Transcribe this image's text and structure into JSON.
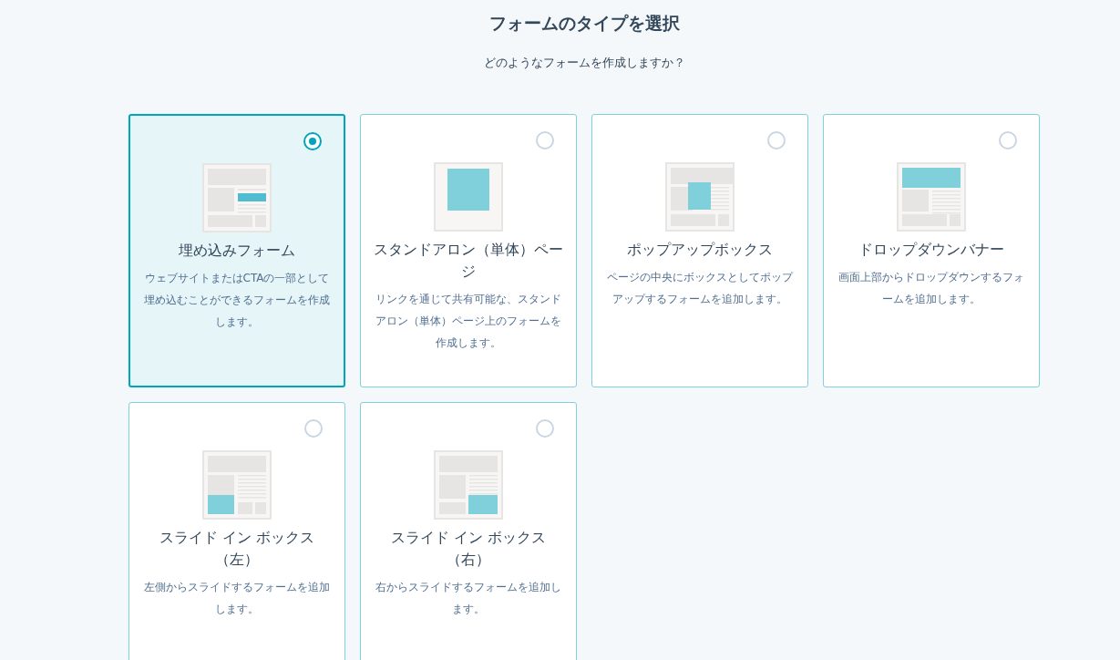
{
  "heading": "フォームのタイプを選択",
  "subheading": "どのようなフォームを作成しますか？",
  "options": [
    {
      "kind": "embedded",
      "title": "埋め込みフォーム",
      "description": "ウェブサイトまたはCTAの一部として埋め込むことができるフォームを作成します。",
      "selected": true
    },
    {
      "kind": "standalone",
      "title": "スタンドアロン（単体）ページ",
      "description": "リンクを通じて共有可能な、スタンドアロン（単体）ページ上のフォームを作成します。",
      "selected": false
    },
    {
      "kind": "popup",
      "title": "ポップアップボックス",
      "description": "ページの中央にボックスとしてポップアップするフォームを追加します。",
      "selected": false
    },
    {
      "kind": "dropdown",
      "title": "ドロップダウンバナー",
      "description": "画面上部からドロップダウンするフォームを追加します。",
      "selected": false
    },
    {
      "kind": "slide-left",
      "title": "スライド イン ボックス（左）",
      "description": "左側からスライドするフォームを追加します。",
      "selected": false
    },
    {
      "kind": "slide-right",
      "title": "スライド イン ボックス（右）",
      "description": "右からスライドするフォームを追加します。",
      "selected": false
    }
  ]
}
